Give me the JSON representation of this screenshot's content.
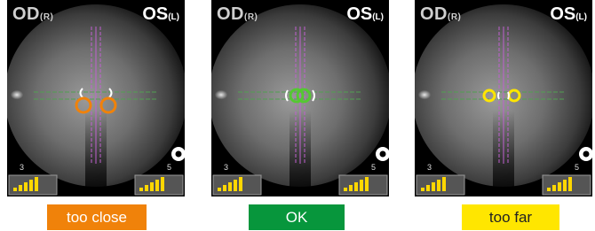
{
  "panels": [
    {
      "od_label": "OD",
      "od_sub": "(R)",
      "os_label": "OS",
      "os_sub": "(L)",
      "level_left": "3",
      "level_right": "5",
      "status": "too close",
      "status_color": "#f0820a",
      "status_text_color": "#ffffff",
      "marker_color": "#f0820a"
    },
    {
      "od_label": "OD",
      "od_sub": "(R)",
      "os_label": "OS",
      "os_sub": "(L)",
      "level_left": "3",
      "level_right": "5",
      "status": "OK",
      "status_color": "#07963c",
      "status_text_color": "#ffffff",
      "marker_color": "#55c832"
    },
    {
      "od_label": "OD",
      "od_sub": "(R)",
      "os_label": "OS",
      "os_sub": "(L)",
      "level_left": "3",
      "level_right": "5",
      "status": "too far",
      "status_color": "#ffe600",
      "status_text_color": "#222222",
      "marker_color": "#ffe600"
    }
  ]
}
